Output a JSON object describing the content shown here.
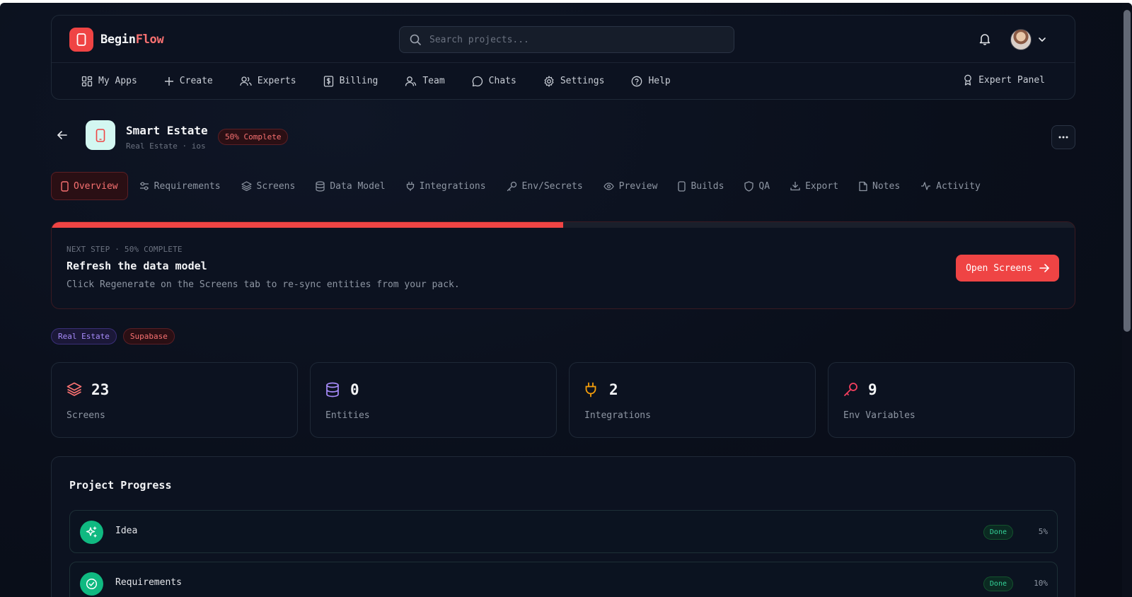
{
  "app": {
    "brand_prefix": "Begin",
    "brand_suffix": "Flow",
    "search_placeholder": "Search projects..."
  },
  "nav": {
    "items": [
      {
        "label": "My Apps",
        "icon": "grid-icon"
      },
      {
        "label": "Create",
        "icon": "plus-icon"
      },
      {
        "label": "Experts",
        "icon": "users-icon"
      },
      {
        "label": "Billing",
        "icon": "dollar-receipt-icon"
      },
      {
        "label": "Team",
        "icon": "user-group-icon"
      },
      {
        "label": "Chats",
        "icon": "chat-bubble-icon"
      },
      {
        "label": "Settings",
        "icon": "gear-icon"
      },
      {
        "label": "Help",
        "icon": "question-circle-icon"
      }
    ],
    "expert_panel": "Expert Panel"
  },
  "project": {
    "title": "Smart Estate",
    "subtitle": "Real Estate · ios",
    "badge": "50% Complete"
  },
  "tabs": [
    {
      "label": "Overview",
      "icon": "phone-icon",
      "active": true
    },
    {
      "label": "Requirements",
      "icon": "sliders-icon"
    },
    {
      "label": "Screens",
      "icon": "layers-icon"
    },
    {
      "label": "Data Model",
      "icon": "database-icon"
    },
    {
      "label": "Integrations",
      "icon": "plug-icon"
    },
    {
      "label": "Env/Secrets",
      "icon": "key-icon"
    },
    {
      "label": "Preview",
      "icon": "eye-icon"
    },
    {
      "label": "Builds",
      "icon": "phone-icon"
    },
    {
      "label": "QA",
      "icon": "shield-icon"
    },
    {
      "label": "Export",
      "icon": "download-icon"
    },
    {
      "label": "Notes",
      "icon": "note-icon"
    },
    {
      "label": "Activity",
      "icon": "activity-icon"
    }
  ],
  "next_step": {
    "kicker": "NEXT STEP · 50% COMPLETE",
    "progress": 0.5,
    "title": "Refresh the data model",
    "description": "Click Regenerate on the Screens tab to re-sync entities from your pack.",
    "button": "Open Screens"
  },
  "tags": [
    "Real Estate",
    "Supabase"
  ],
  "stats": [
    {
      "value": "23",
      "label": "Screens",
      "icon": "layers-icon",
      "color": "#f87171"
    },
    {
      "value": "0",
      "label": "Entities",
      "icon": "database-icon",
      "color": "#a78bfa"
    },
    {
      "value": "2",
      "label": "Integrations",
      "icon": "plug-icon",
      "color": "#f59e0b"
    },
    {
      "value": "9",
      "label": "Env Variables",
      "icon": "key-icon",
      "color": "#f43f5e"
    }
  ],
  "progress": {
    "title": "Project Progress",
    "stages": [
      {
        "name": "Idea",
        "status": "Done",
        "pct": "5%",
        "icon": "sparkles-icon"
      },
      {
        "name": "Requirements",
        "status": "Done",
        "pct": "10%",
        "icon": "check-circle-icon"
      }
    ]
  },
  "colors": {
    "accent": "#ef4444",
    "success": "#10b981",
    "background": "#0a0f1b"
  }
}
